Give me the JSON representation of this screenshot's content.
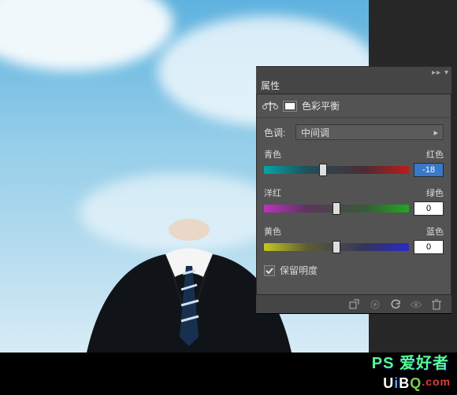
{
  "panel": {
    "title": "属性",
    "adjustment_type": "色彩平衡",
    "tone_label": "色调:",
    "tone_value": "中间调",
    "sliders": {
      "cr": {
        "left": "青色",
        "right": "红色",
        "value": "-18",
        "pos_pct": 41
      },
      "mg": {
        "left": "洋红",
        "right": "绿色",
        "value": "0",
        "pos_pct": 50
      },
      "yb": {
        "left": "黄色",
        "right": "蓝色",
        "value": "0",
        "pos_pct": 50
      }
    },
    "preserve": {
      "label": "保留明度",
      "checked": true
    }
  },
  "footer_icons": [
    "clip-icon",
    "view-icon",
    "reset-icon",
    "visibility-icon",
    "trash-icon"
  ],
  "watermark": "PS 爱好者",
  "site": {
    "u": "U",
    "i": "i",
    "b": "B",
    "q": "Q",
    "dot": ".com"
  }
}
